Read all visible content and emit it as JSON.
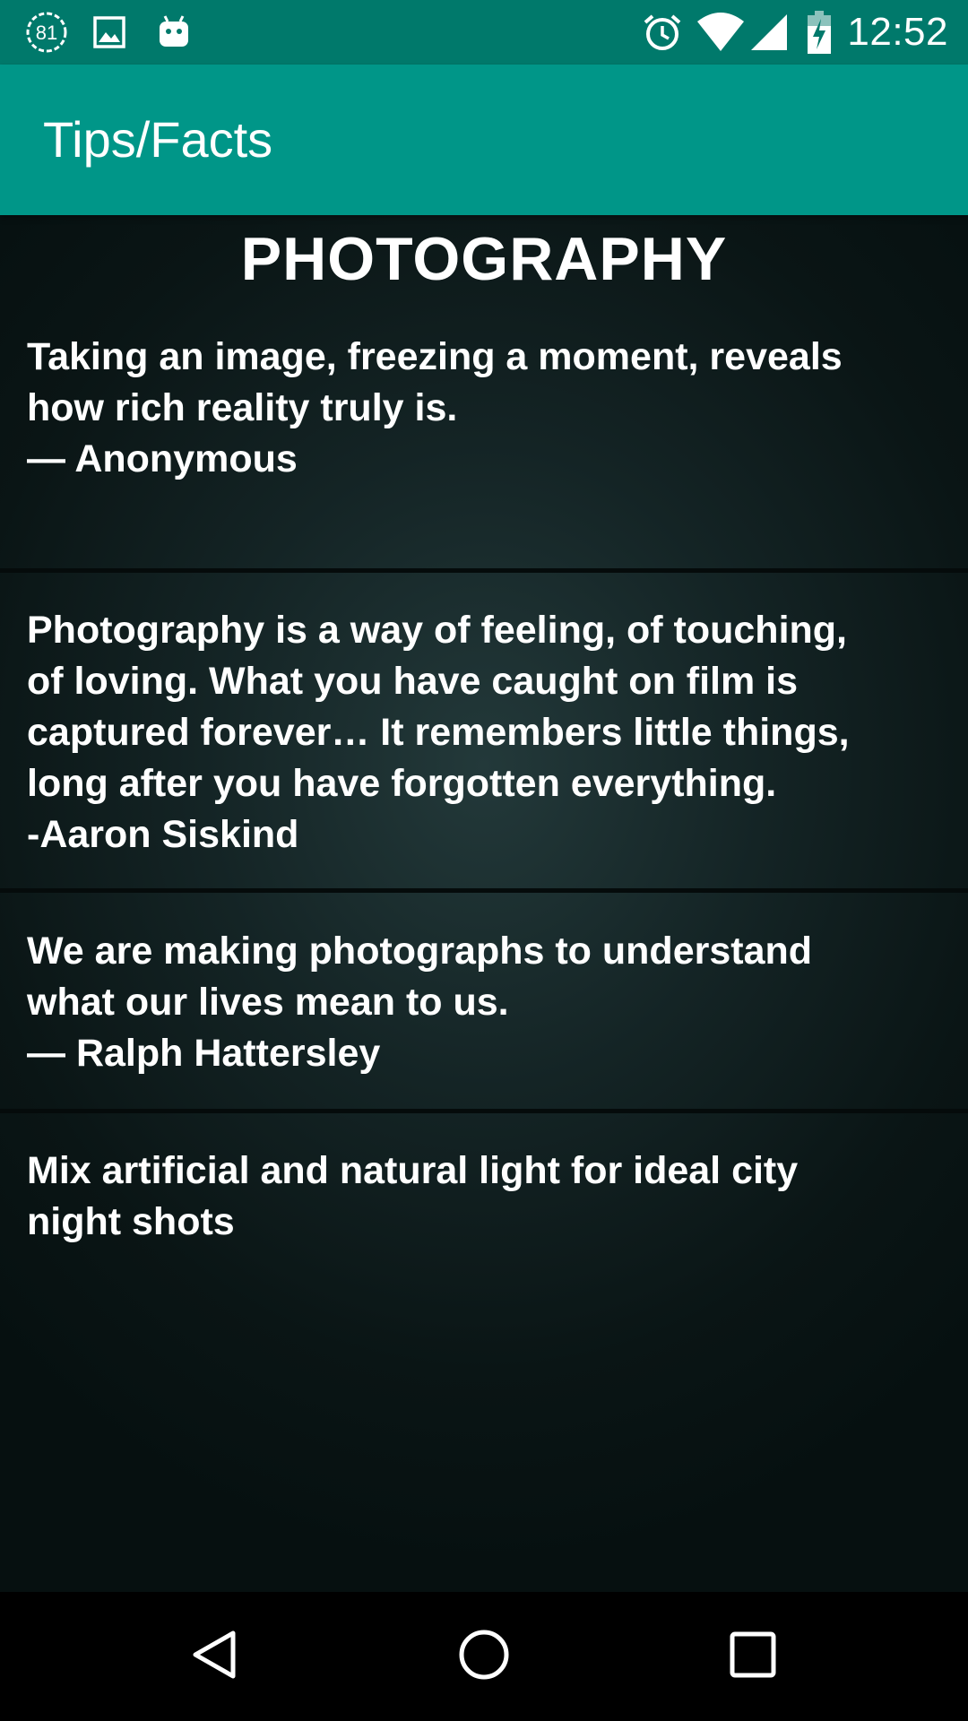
{
  "status_bar": {
    "time": "12:52",
    "notification_badge": "81",
    "icons_left": [
      "update-count-icon",
      "image-icon",
      "android-icon"
    ],
    "icons_right": [
      "alarm-icon",
      "wifi-icon",
      "signal-icon",
      "battery-charging-icon"
    ]
  },
  "app_bar": {
    "title": "Tips/Facts",
    "color": "#009688"
  },
  "content": {
    "section_title": "PHOTOGRAPHY",
    "quotes": [
      {
        "text": "Taking an image, freezing a moment, reveals\nhow rich reality truly is.\n— Anonymous"
      },
      {
        "text": "Photography is a way of feeling, of touching,\nof loving. What you have caught on film is\ncaptured forever… It remembers little things,\nlong after you have forgotten everything.\n -Aaron Siskind"
      },
      {
        "text": "We are making photographs to understand\nwhat our lives mean to us.\n— Ralph Hattersley"
      },
      {
        "text": "Mix artificial and natural light for ideal city\nnight shots"
      }
    ]
  },
  "nav_bar": {
    "buttons": [
      "back-icon",
      "home-icon",
      "recents-icon"
    ]
  }
}
